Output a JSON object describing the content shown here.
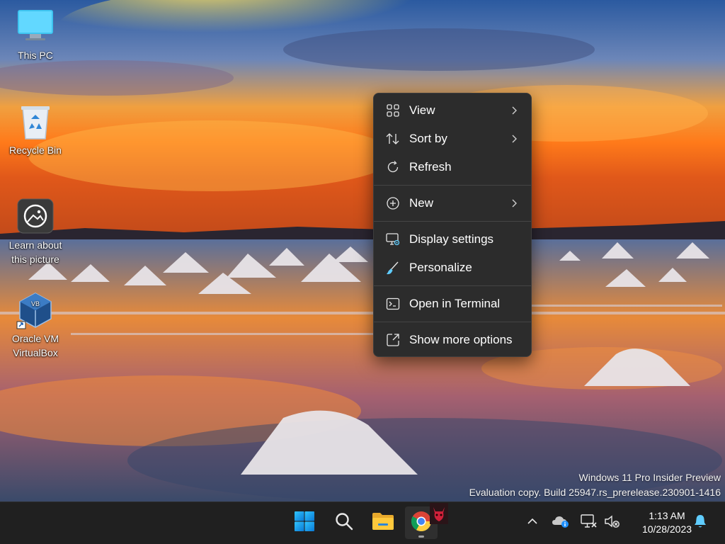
{
  "desktop": {
    "icons": [
      {
        "label": "This PC"
      },
      {
        "label": "Recycle Bin"
      },
      {
        "label_line1": "Learn about",
        "label_line2": "this picture"
      },
      {
        "label_line1": "Oracle VM",
        "label_line2": "VirtualBox"
      }
    ]
  },
  "context_menu": {
    "items": [
      {
        "label": "View",
        "icon": "grid-icon",
        "has_submenu": true
      },
      {
        "label": "Sort by",
        "icon": "sort-icon",
        "has_submenu": true
      },
      {
        "label": "Refresh",
        "icon": "refresh-icon",
        "has_submenu": false
      },
      {
        "label": "New",
        "icon": "plus-circle-icon",
        "has_submenu": true
      },
      {
        "label": "Display settings",
        "icon": "display-settings-icon",
        "has_submenu": false
      },
      {
        "label": "Personalize",
        "icon": "brush-icon",
        "has_submenu": false
      },
      {
        "label": "Open in Terminal",
        "icon": "terminal-icon",
        "has_submenu": false
      },
      {
        "label": "Show more options",
        "icon": "expand-icon",
        "has_submenu": false
      }
    ]
  },
  "watermark": {
    "line1": "Windows 11 Pro Insider Preview",
    "line2": "Evaluation copy. Build 25947.rs_prerelease.230901-1416"
  },
  "taskbar": {
    "apps": [
      {
        "name": "start",
        "icon": "windows-logo-icon"
      },
      {
        "name": "search",
        "icon": "search-icon"
      },
      {
        "name": "file-explorer",
        "icon": "folder-icon"
      },
      {
        "name": "chrome",
        "icon": "chrome-icon",
        "active": true
      }
    ],
    "tray": {
      "icons": [
        "chevron-up-icon",
        "onedrive-icon",
        "network-icon",
        "volume-muted-icon",
        "notification-bell-icon"
      ],
      "time": "1:13 AM",
      "date": "10/28/2023"
    }
  },
  "colors": {
    "menu_bg": "#2c2c2c",
    "taskbar_bg": "#202020",
    "accent": "#60cdff"
  }
}
